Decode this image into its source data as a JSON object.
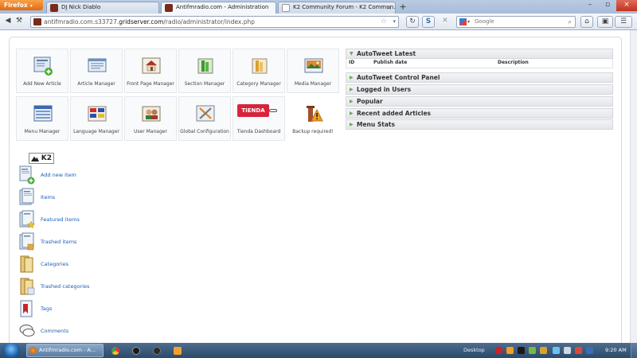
{
  "browser": {
    "app_button": "Firefox",
    "tabs": [
      {
        "title": "DJ Nick Diablo",
        "active": false
      },
      {
        "title": "Antifmradio.com - Administration",
        "active": true
      },
      {
        "title": "K2 Community Forum - K2 Commun...",
        "active": false
      }
    ],
    "url_prefix": "antifmradio.com.s33727.",
    "url_host": "gridserver.com",
    "url_path": "/radio/administrator/index.php",
    "search_placeholder": "Google"
  },
  "control_panel": {
    "buttons": [
      {
        "label": "Add New Article"
      },
      {
        "label": "Article Manager"
      },
      {
        "label": "Front Page Manager"
      },
      {
        "label": "Section Manager"
      },
      {
        "label": "Category Manager"
      },
      {
        "label": "Media Manager"
      },
      {
        "label": "Menu Manager"
      },
      {
        "label": "Language Manager"
      },
      {
        "label": "User Manager"
      },
      {
        "label": "Global Configuration"
      },
      {
        "label": "Tienda Dashboard",
        "badge": "TIENDA"
      },
      {
        "label": "Backup required!"
      }
    ]
  },
  "k2": {
    "logo": "K2",
    "items": [
      {
        "label": "Add new item"
      },
      {
        "label": "Items"
      },
      {
        "label": "Featured items"
      },
      {
        "label": "Trashed items"
      },
      {
        "label": "Categories"
      },
      {
        "label": "Trashed categories"
      },
      {
        "label": "Tags"
      },
      {
        "label": "Comments"
      }
    ]
  },
  "modules": {
    "autotweet_latest": {
      "title": "AutoTweet Latest",
      "columns": [
        "ID",
        "Publish date",
        "Description"
      ]
    },
    "others": [
      {
        "title": "AutoTweet Control Panel"
      },
      {
        "title": "Logged in Users"
      },
      {
        "title": "Popular"
      },
      {
        "title": "Recent added Articles"
      },
      {
        "title": "Menu Stats"
      }
    ]
  },
  "taskbar": {
    "active_window": "Antifmradio.com - A...",
    "desktop_label": "Desktop",
    "clock": "9:20 AM"
  }
}
